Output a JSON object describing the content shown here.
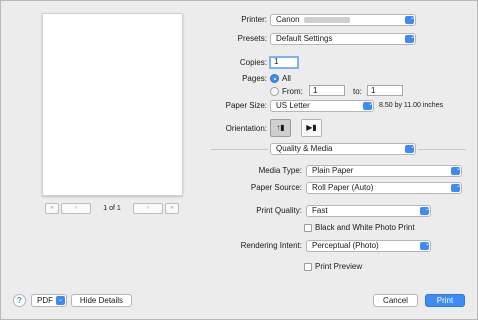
{
  "preview": {
    "page_indicator": "1 of 1",
    "first_glyph": "«",
    "prev_glyph": "‹",
    "next_glyph": "›",
    "last_glyph": "»"
  },
  "printer": {
    "label": "Printer:",
    "value": "Canon"
  },
  "presets": {
    "label": "Presets:",
    "value": "Default Settings"
  },
  "copies": {
    "label": "Copies:",
    "value": "1"
  },
  "pages": {
    "label": "Pages:",
    "all_label": "All",
    "from_label": "From:",
    "from_value": "1",
    "to_label": "to:",
    "to_value": "1",
    "selected": "All"
  },
  "paper_size": {
    "label": "Paper Size:",
    "value": "US Letter",
    "dimensions": "8.50 by 11.00 inches"
  },
  "orientation": {
    "label": "Orientation:",
    "portrait_glyph": "↑▮",
    "landscape_glyph": "▶▮",
    "selected": "portrait"
  },
  "section": {
    "value": "Quality & Media"
  },
  "media_type": {
    "label": "Media Type:",
    "value": "Plain Paper"
  },
  "paper_source": {
    "label": "Paper Source:",
    "value": "Roll Paper (Auto)"
  },
  "print_quality": {
    "label": "Print Quality:",
    "value": "Fast"
  },
  "bw_photo": {
    "label": "Black and White Photo Print",
    "checked": false
  },
  "rendering_intent": {
    "label": "Rendering Intent:",
    "value": "Perceptual (Photo)"
  },
  "print_preview": {
    "label": "Print Preview",
    "checked": false
  },
  "footer": {
    "help": "?",
    "pdf": "PDF",
    "hide_details": "Hide Details",
    "cancel": "Cancel",
    "print": "Print"
  },
  "popup_chevron": "⌃⌄",
  "colors": {
    "accent": "#3d8bf5",
    "background": "#ececec"
  }
}
